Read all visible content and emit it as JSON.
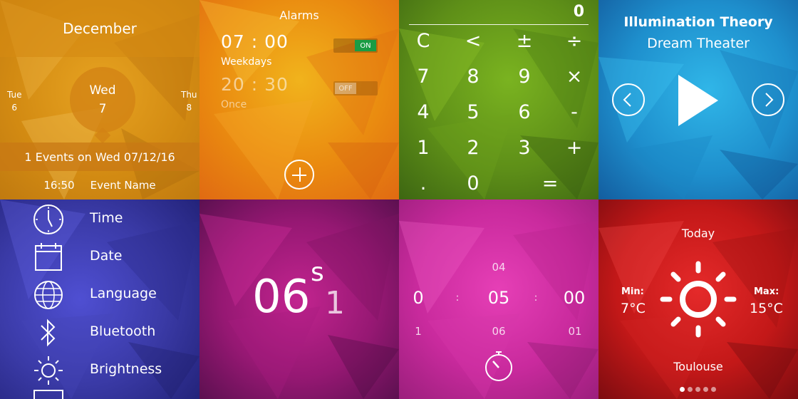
{
  "calendar": {
    "month": "December",
    "prev_day": {
      "name": "Tue",
      "num": "6"
    },
    "current_day": {
      "name": "Wed",
      "num": "7"
    },
    "next_day": {
      "name": "Thu",
      "num": "8"
    },
    "events_summary": "1 Events on Wed 07/12/16",
    "event": {
      "time": "16:50",
      "name": "Event Name"
    }
  },
  "alarms": {
    "title": "Alarms",
    "items": [
      {
        "time": "07 : 00",
        "repeat": "Weekdays",
        "toggle": "ON"
      },
      {
        "time": "20 : 30",
        "repeat": "Once",
        "toggle": "OFF"
      }
    ],
    "add_icon": "plus-circle-icon"
  },
  "calculator": {
    "display": "0",
    "keys": [
      [
        "C",
        "<",
        "±",
        "÷"
      ],
      [
        "7",
        "8",
        "9",
        "×"
      ],
      [
        "4",
        "5",
        "6",
        "-"
      ],
      [
        "1",
        "2",
        "3",
        "+"
      ],
      [
        ".",
        "0",
        "=",
        ""
      ]
    ]
  },
  "music": {
    "title": "Illumination Theory",
    "artist": "Dream Theater",
    "prev_icon": "chevron-left-icon",
    "play_icon": "play-icon",
    "next_icon": "chevron-right-icon"
  },
  "settings": {
    "items": [
      {
        "label": "Time",
        "icon": "clock-icon"
      },
      {
        "label": "Date",
        "icon": "calendar-icon"
      },
      {
        "label": "Language",
        "icon": "globe-icon"
      },
      {
        "label": "Bluetooth",
        "icon": "bluetooth-icon"
      },
      {
        "label": "Brightness",
        "icon": "sun-icon"
      }
    ]
  },
  "stopwatch": {
    "seconds": "06",
    "unit": "s",
    "tenths": "1"
  },
  "timer": {
    "above": [
      "",
      "04",
      ""
    ],
    "current": [
      "0",
      "05",
      "00"
    ],
    "below": [
      "1",
      "06",
      "01"
    ],
    "separator": ":",
    "icon": "timer-icon"
  },
  "weather": {
    "day": "Today",
    "min_label": "Min:",
    "min_value": "7°C",
    "max_label": "Max:",
    "max_value": "15°C",
    "city": "Toulouse",
    "icon": "sun-icon",
    "page_count": 5,
    "active_page": 1
  }
}
